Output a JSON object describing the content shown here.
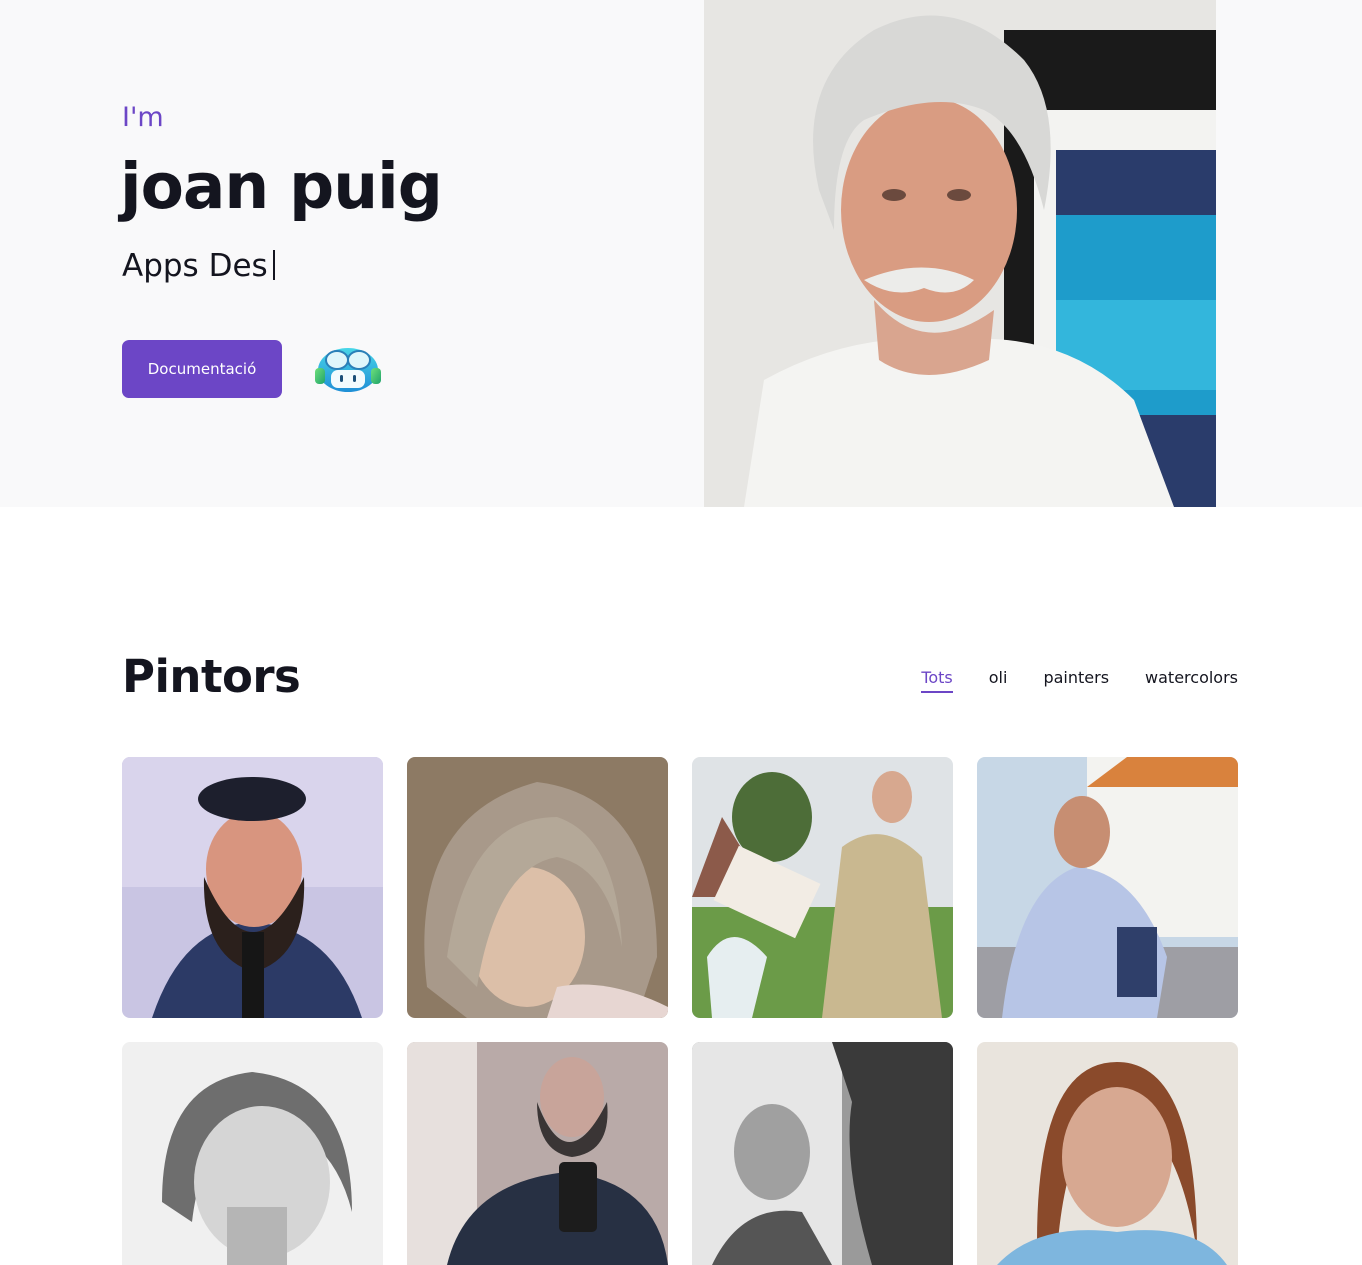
{
  "hero": {
    "intro": "I'm",
    "name": "joan puig",
    "typing_text": "Apps Des",
    "button_label": "Documentació"
  },
  "section": {
    "title": "Pintors",
    "filters": [
      "Tots",
      "oli",
      "painters",
      "watercolors"
    ],
    "active_filter": "Tots"
  },
  "colors": {
    "accent": "#6c46c6",
    "text": "#14151f",
    "hero_bg": "#f9f9fa"
  },
  "icons": [
    "copilot-icon"
  ]
}
